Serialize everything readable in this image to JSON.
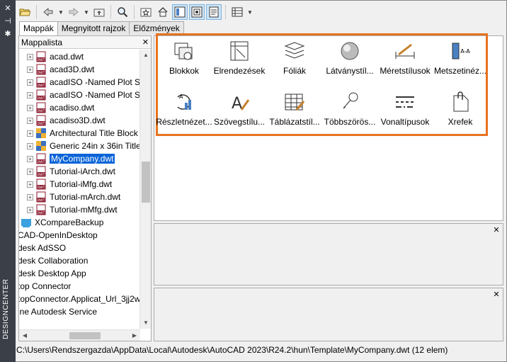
{
  "window": {
    "side_label": "DESIGNCENTER",
    "close_glyph": "✕",
    "pin_glyph": "⊣",
    "settings_glyph": "✱"
  },
  "toolbar": {
    "buttons": [
      {
        "icon": "open-folder-icon"
      },
      {
        "icon": "back-arrow-icon"
      },
      {
        "icon": "forward-arrow-icon"
      },
      {
        "icon": "up-folder-icon"
      },
      {
        "icon": "search-icon"
      },
      {
        "icon": "favorites-icon"
      },
      {
        "icon": "home-icon"
      },
      {
        "icon": "tree-view-toggle-icon"
      },
      {
        "icon": "preview-toggle-icon"
      },
      {
        "icon": "description-toggle-icon"
      },
      {
        "icon": "views-icon"
      }
    ]
  },
  "tabs": [
    {
      "label": "Mappák",
      "active": true
    },
    {
      "label": "Megnyitott rajzok",
      "active": false
    },
    {
      "label": "Előzmények",
      "active": false
    }
  ],
  "tree": {
    "header": "Mappalista",
    "close": "✕",
    "items": [
      {
        "label": "acad.dwt",
        "kind": "dwt",
        "indent": 1
      },
      {
        "label": "acad3D.dwt",
        "kind": "dwt",
        "indent": 1
      },
      {
        "label": "acadISO -Named Plot S",
        "kind": "dwt",
        "indent": 1
      },
      {
        "label": "acadISO -Named Plot S",
        "kind": "dwt",
        "indent": 1
      },
      {
        "label": "acadiso.dwt",
        "kind": "dwt",
        "indent": 1
      },
      {
        "label": "acadiso3D.dwt",
        "kind": "dwt",
        "indent": 1
      },
      {
        "label": "Architectural Title Block",
        "kind": "dwg",
        "indent": 1
      },
      {
        "label": "Generic 24in x 36in Title",
        "kind": "dwg",
        "indent": 1
      },
      {
        "label": "MyCompany.dwt",
        "kind": "dwt",
        "indent": 1,
        "selected": true
      },
      {
        "label": "Tutorial-iArch.dwt",
        "kind": "dwt",
        "indent": 1
      },
      {
        "label": "Tutorial-iMfg.dwt",
        "kind": "dwt",
        "indent": 1
      },
      {
        "label": "Tutorial-mArch.dwt",
        "kind": "dwt",
        "indent": 1
      },
      {
        "label": "Tutorial-mMfg.dwt",
        "kind": "dwt",
        "indent": 1
      },
      {
        "label": "XCompareBackup",
        "kind": "folder",
        "indent": 0
      },
      {
        "label": "CAD-OpenInDesktop",
        "kind": "none",
        "indent": -1
      },
      {
        "label": "desk AdSSO",
        "kind": "none",
        "indent": -1
      },
      {
        "label": "desk Collaboration",
        "kind": "none",
        "indent": -1
      },
      {
        "label": "desk Desktop App",
        "kind": "none",
        "indent": -1
      },
      {
        "label": "top Connector",
        "kind": "none",
        "indent": -1
      },
      {
        "label": "topConnector.Applicat_Url_3jj2w",
        "kind": "none",
        "indent": -1
      },
      {
        "label": "ine Autodesk Service",
        "kind": "none",
        "indent": -1
      }
    ]
  },
  "content": {
    "items": [
      {
        "label": "Blokkok",
        "icon": "blocks-icon"
      },
      {
        "label": "Elrendezések",
        "icon": "layouts-icon"
      },
      {
        "label": "Fóliák",
        "icon": "layers-icon"
      },
      {
        "label": "Látványstíl...",
        "icon": "visual-styles-icon"
      },
      {
        "label": "Méretstílusok",
        "icon": "dimstyles-icon"
      },
      {
        "label": "Metszetinéz...",
        "icon": "section-view-styles-icon"
      },
      {
        "label": "Részletnézet...",
        "icon": "detail-view-styles-icon"
      },
      {
        "label": "Szövegstílu...",
        "icon": "text-styles-icon"
      },
      {
        "label": "Táblázatstíl...",
        "icon": "table-styles-icon"
      },
      {
        "label": "Többszörös...",
        "icon": "multileader-styles-icon"
      },
      {
        "label": "Vonaltípusok",
        "icon": "linetypes-icon"
      },
      {
        "label": "Xrefek",
        "icon": "xrefs-icon"
      }
    ]
  },
  "preview": {
    "close": "✕"
  },
  "description": {
    "close": "✕"
  },
  "status": {
    "path": "C:\\Users\\Rendszergazda\\AppData\\Local\\Autodesk\\AutoCAD 2023\\R24.2\\hun\\Template\\MyCompany.dwt (12 elem)"
  },
  "colors": {
    "highlight": "#e8731f",
    "selection": "#0a64d8",
    "side_strip": "#3b3f48"
  }
}
